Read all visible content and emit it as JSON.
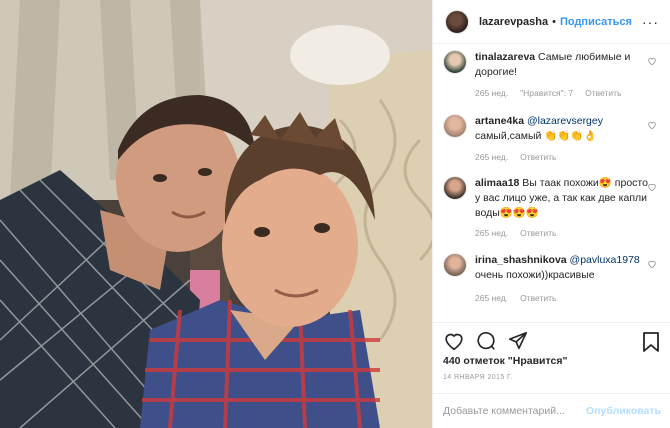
{
  "post": {
    "header": {
      "username": "lazarevpasha",
      "separator": "•",
      "follow_label": "Подписаться",
      "more_label": "···"
    },
    "comments": [
      {
        "username": "tinalazareva",
        "text": "Самые любимые и дорогие!",
        "time": "265 нед.",
        "likes_label": "\"Нравится\": 7",
        "reply_label": "Ответить"
      },
      {
        "username": "artane4ka",
        "mention": "@lazarevsergey",
        "text": "самый,самый 👏👏👏👌",
        "time": "265 нед.",
        "reply_label": "Ответить"
      },
      {
        "username": "alimaa18",
        "text": "Вы таак похожи😍 просто у вас лицо уже, а так как две капли воды😍😍😍",
        "time": "265 нед.",
        "reply_label": "Ответить"
      },
      {
        "username": "irina_shashnikova",
        "mention": "@pavluxa1978",
        "text": "очень похожи))красивые",
        "time": "265 нед.",
        "reply_label": "Ответить"
      }
    ],
    "likes": "440 отметок \"Нравится\"",
    "date": "14 ЯНВАРЯ 2015 Г.",
    "add_comment": {
      "placeholder": "Добавьте комментарий...",
      "publish_label": "Опубликовать"
    },
    "icons": [
      "heart-icon",
      "comment-icon",
      "share-icon",
      "bookmark-icon"
    ],
    "colors": {
      "link": "#3897f0",
      "publish_disabled": "#b2dffc",
      "meta": "#999999",
      "text": "#262626",
      "border": "#efefef"
    }
  }
}
